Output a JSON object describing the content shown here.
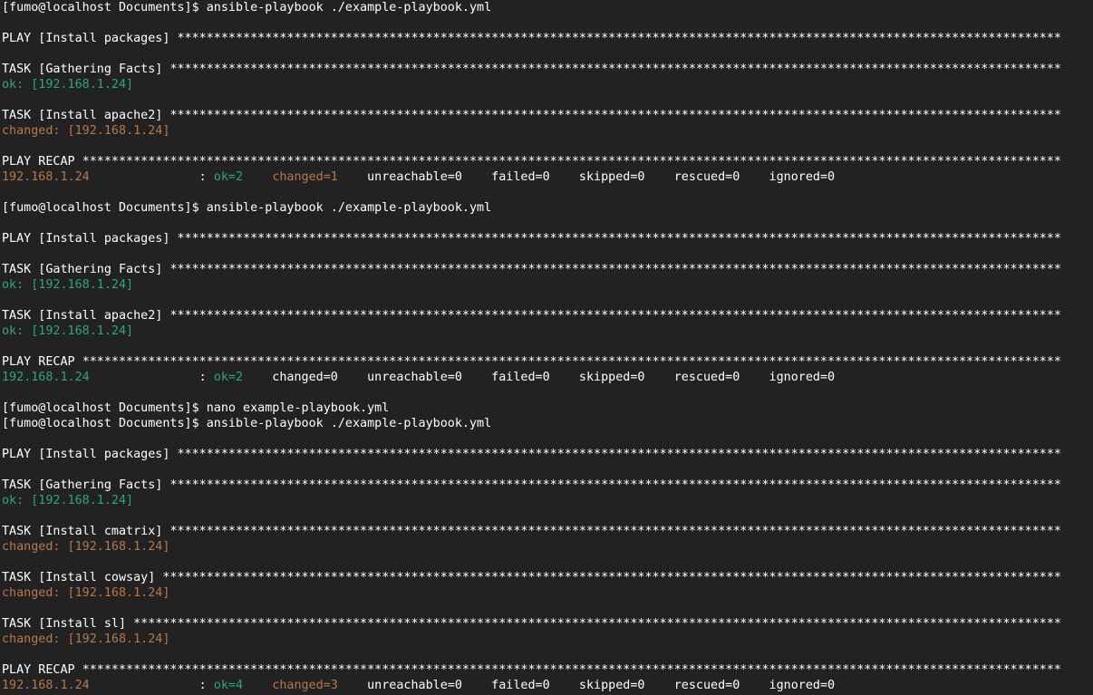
{
  "colors": {
    "background": "#222222",
    "default": "#ffffff",
    "green": "#2fa57a",
    "orange": "#b9774a"
  },
  "lines": [
    {
      "type": "prompt",
      "segments": [
        {
          "text": "[fumo@localhost Documents]$ ansible-playbook ./example-playbook.yml",
          "color": "white"
        }
      ]
    },
    {
      "type": "blank",
      "segments": []
    },
    {
      "type": "header",
      "label": "PLAY [Install packages] "
    },
    {
      "type": "blank",
      "segments": []
    },
    {
      "type": "header",
      "label": "TASK [Gathering Facts] "
    },
    {
      "type": "status",
      "segments": [
        {
          "text": "ok: [192.168.1.24]",
          "color": "green"
        }
      ]
    },
    {
      "type": "blank",
      "segments": []
    },
    {
      "type": "header",
      "label": "TASK [Install apache2] "
    },
    {
      "type": "status",
      "segments": [
        {
          "text": "changed: [192.168.1.24]",
          "color": "orange"
        }
      ]
    },
    {
      "type": "blank",
      "segments": []
    },
    {
      "type": "header",
      "label": "PLAY RECAP "
    },
    {
      "type": "recap",
      "segments": [
        {
          "text": "192.168.1.24",
          "color": "orange"
        },
        {
          "text": "               : ",
          "color": "white"
        },
        {
          "text": "ok=2",
          "color": "green"
        },
        {
          "text": "    ",
          "color": "white"
        },
        {
          "text": "changed=1",
          "color": "orange"
        },
        {
          "text": "    unreachable=0    failed=0    skipped=0    rescued=0    ignored=0",
          "color": "white"
        }
      ]
    },
    {
      "type": "blank",
      "segments": []
    },
    {
      "type": "prompt",
      "segments": [
        {
          "text": "[fumo@localhost Documents]$ ansible-playbook ./example-playbook.yml",
          "color": "white"
        }
      ]
    },
    {
      "type": "blank",
      "segments": []
    },
    {
      "type": "header",
      "label": "PLAY [Install packages] "
    },
    {
      "type": "blank",
      "segments": []
    },
    {
      "type": "header",
      "label": "TASK [Gathering Facts] "
    },
    {
      "type": "status",
      "segments": [
        {
          "text": "ok: [192.168.1.24]",
          "color": "green"
        }
      ]
    },
    {
      "type": "blank",
      "segments": []
    },
    {
      "type": "header",
      "label": "TASK [Install apache2] "
    },
    {
      "type": "status",
      "segments": [
        {
          "text": "ok: [192.168.1.24]",
          "color": "green"
        }
      ]
    },
    {
      "type": "blank",
      "segments": []
    },
    {
      "type": "header",
      "label": "PLAY RECAP "
    },
    {
      "type": "recap",
      "segments": [
        {
          "text": "192.168.1.24",
          "color": "green"
        },
        {
          "text": "               : ",
          "color": "white"
        },
        {
          "text": "ok=2",
          "color": "green"
        },
        {
          "text": "    changed=0    unreachable=0    failed=0    skipped=0    rescued=0    ignored=0",
          "color": "white"
        }
      ]
    },
    {
      "type": "blank",
      "segments": []
    },
    {
      "type": "prompt",
      "segments": [
        {
          "text": "[fumo@localhost Documents]$ nano example-playbook.yml",
          "color": "white"
        }
      ]
    },
    {
      "type": "prompt",
      "segments": [
        {
          "text": "[fumo@localhost Documents]$ ansible-playbook ./example-playbook.yml",
          "color": "white"
        }
      ]
    },
    {
      "type": "blank",
      "segments": []
    },
    {
      "type": "header",
      "label": "PLAY [Install packages] "
    },
    {
      "type": "blank",
      "segments": []
    },
    {
      "type": "header",
      "label": "TASK [Gathering Facts] "
    },
    {
      "type": "status",
      "segments": [
        {
          "text": "ok: [192.168.1.24]",
          "color": "green"
        }
      ]
    },
    {
      "type": "blank",
      "segments": []
    },
    {
      "type": "header",
      "label": "TASK [Install cmatrix] "
    },
    {
      "type": "status",
      "segments": [
        {
          "text": "changed: [192.168.1.24]",
          "color": "orange"
        }
      ]
    },
    {
      "type": "blank",
      "segments": []
    },
    {
      "type": "header",
      "label": "TASK [Install cowsay] "
    },
    {
      "type": "status",
      "segments": [
        {
          "text": "changed: [192.168.1.24]",
          "color": "orange"
        }
      ]
    },
    {
      "type": "blank",
      "segments": []
    },
    {
      "type": "header",
      "label": "TASK [Install sl] "
    },
    {
      "type": "status",
      "segments": [
        {
          "text": "changed: [192.168.1.24]",
          "color": "orange"
        }
      ]
    },
    {
      "type": "blank",
      "segments": []
    },
    {
      "type": "header",
      "label": "PLAY RECAP "
    },
    {
      "type": "recap",
      "segments": [
        {
          "text": "192.168.1.24",
          "color": "orange"
        },
        {
          "text": "               : ",
          "color": "white"
        },
        {
          "text": "ok=4",
          "color": "green"
        },
        {
          "text": "    ",
          "color": "white"
        },
        {
          "text": "changed=3",
          "color": "orange"
        },
        {
          "text": "    unreachable=0    failed=0    skipped=0    rescued=0    ignored=0",
          "color": "white"
        }
      ]
    }
  ]
}
